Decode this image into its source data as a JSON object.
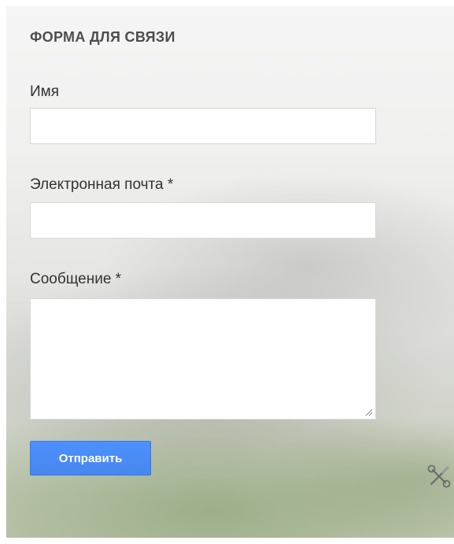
{
  "form": {
    "title": "ФОРМА ДЛЯ СВЯЗИ",
    "fields": [
      {
        "label": "Имя",
        "value": "",
        "placeholder": ""
      },
      {
        "label": "Электронная почта *",
        "value": "",
        "placeholder": ""
      },
      {
        "label": "Сообщение *",
        "value": "",
        "placeholder": ""
      }
    ],
    "submit_label": "Отправить"
  },
  "icons": {
    "edit_tools": "wrench-screwdriver-icon"
  },
  "colors": {
    "button": "#4d90fe",
    "title_text": "#4d4d4d",
    "label_text": "#333333"
  }
}
